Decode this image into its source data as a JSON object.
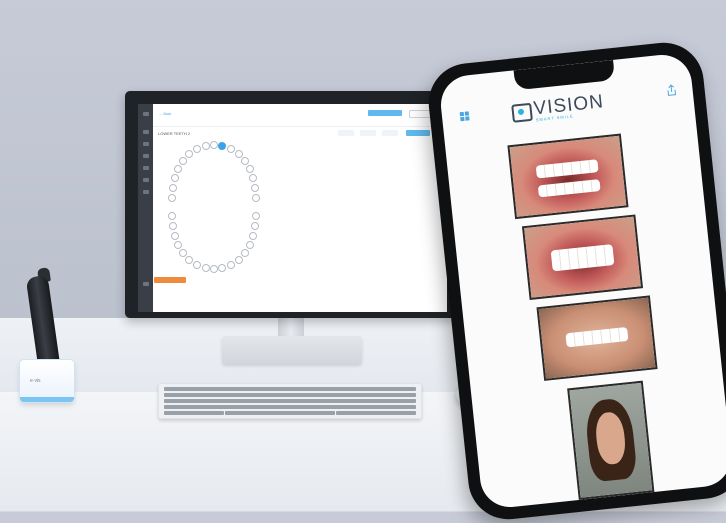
{
  "scene": {
    "desc": "Dental workstation product photo",
    "monitor": {
      "crumb": "← Back",
      "title": "LOWER TEETH  2"
    },
    "scanner": {
      "dock_label": "e·vis"
    },
    "phone": {
      "brand_name": "VISION",
      "brand_sub": "SMART  SMILE",
      "photos": [
        {
          "kind": "intraoral-open-mouth"
        },
        {
          "kind": "intraoral-closed-bite"
        },
        {
          "kind": "smile-closeup"
        },
        {
          "kind": "portrait-selfie"
        }
      ]
    }
  }
}
